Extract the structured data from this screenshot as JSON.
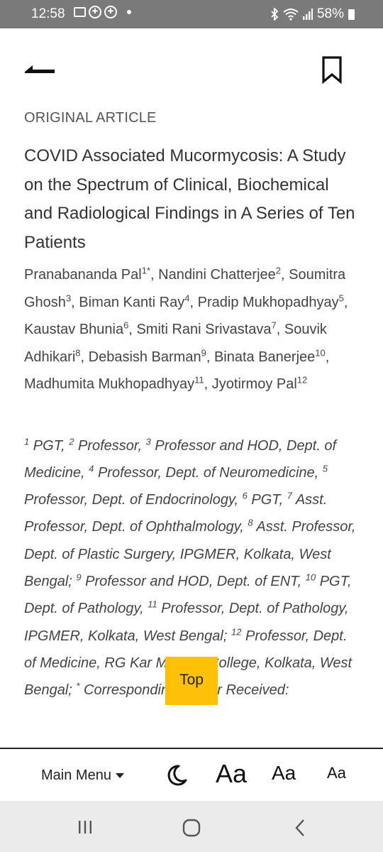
{
  "status_bar": {
    "time": "12:58",
    "battery": "58%",
    "icons": [
      "gallery-icon",
      "app-icon",
      "app-icon",
      "notification-dot",
      "bluetooth-icon",
      "wifi-icon",
      "signal-icon",
      "battery-icon"
    ]
  },
  "app_bar": {
    "back_icon": "back-arrow-icon",
    "bookmark_icon": "bookmark-icon"
  },
  "article": {
    "kicker": "ORIGINAL ARTICLE",
    "title": "COVID Associated Mucormycosis: A Study on the Spectrum of Clinical, Biochemical and Radiological Findings in A Series of Ten Patients",
    "authors": [
      {
        "name": "Pranabananda Pal",
        "sup": "1*"
      },
      {
        "name": "Nandini Chatterjee",
        "sup": "2"
      },
      {
        "name": "Soumitra Ghosh",
        "sup": "3"
      },
      {
        "name": "Biman Kanti Ray",
        "sup": "4"
      },
      {
        "name": "Pradip Mukhopadhyay",
        "sup": "5"
      },
      {
        "name": "Kaustav Bhunia",
        "sup": "6"
      },
      {
        "name": "Smiti Rani Srivastava",
        "sup": "7"
      },
      {
        "name": "Souvik Adhikari",
        "sup": "8"
      },
      {
        "name": "Debasish Barman",
        "sup": "9"
      },
      {
        "name": "Binata Banerjee",
        "sup": "10"
      },
      {
        "name": "Madhumita Mukhopadhyay",
        "sup": "11"
      },
      {
        "name": "Jyotirmoy Pal",
        "sup": "12"
      }
    ],
    "affiliations": [
      {
        "sup": "1",
        "text": "PGT,"
      },
      {
        "sup": "2",
        "text": "Professor,"
      },
      {
        "sup": "3",
        "text": "Professor and HOD, Dept. of Medicine,"
      },
      {
        "sup": "4",
        "text": "Professor, Dept. of Neuromedicine,"
      },
      {
        "sup": "5",
        "text": "Professor, Dept. of Endocrinology,"
      },
      {
        "sup": "6",
        "text": "PGT,"
      },
      {
        "sup": "7",
        "text": "Asst. Professor, Dept. of Ophthalmology,"
      },
      {
        "sup": "8",
        "text": "Asst. Professor, Dept. of Plastic Surgery, IPGMER, Kolkata, West Bengal;"
      },
      {
        "sup": "9",
        "text": "Professor and HOD, Dept. of ENT,"
      },
      {
        "sup": "10",
        "text": "PGT, Dept. of Pathology,"
      },
      {
        "sup": "11",
        "text": "Professor, Dept. of Pathology, IPGMER, Kolkata, West Bengal;"
      },
      {
        "sup": "12",
        "text": "Professor, Dept. of Medicine, RG Kar Medical College, Kolkata, West Bengal;"
      },
      {
        "sup": "*",
        "text": "Corresponding Author Received:"
      }
    ]
  },
  "top_button": {
    "label": "Top",
    "color": "#ffc107"
  },
  "bottom_toolbar": {
    "main_menu_label": "Main Menu",
    "night_mode_icon": "moon-icon",
    "font_large": "Aa",
    "font_medium": "Aa",
    "font_small": "Aa"
  },
  "nav_bar": {
    "recents_icon": "recents-icon",
    "home_icon": "home-icon",
    "back_icon": "nav-back-icon"
  },
  "colors": {
    "status_bar_bg": "#7a7a7a",
    "accent": "#ffc107",
    "nav_bar_bg": "#ebebeb"
  }
}
